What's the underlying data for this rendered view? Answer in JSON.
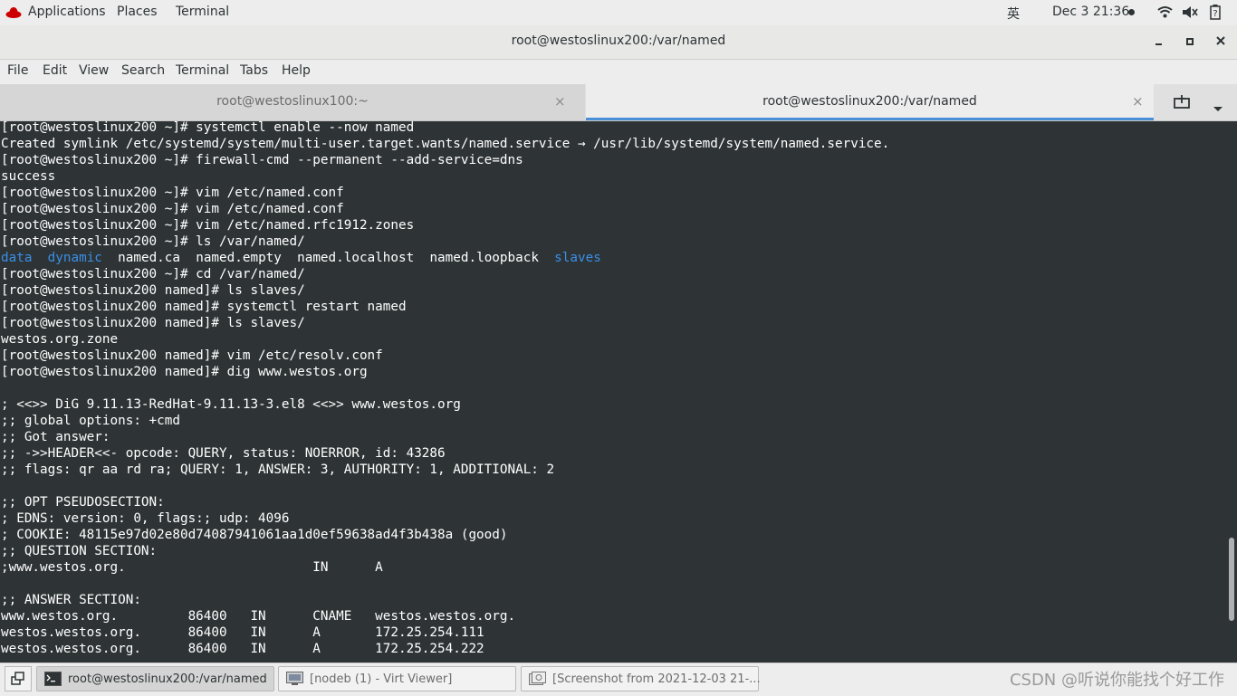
{
  "topbar": {
    "applications": "Applications",
    "places": "Places",
    "terminal": "Terminal",
    "input_method": "英",
    "datetime": "Dec 3  21:36"
  },
  "window": {
    "title": "root@westoslinux200:/var/named"
  },
  "menu": [
    "File",
    "Edit",
    "View",
    "Search",
    "Terminal",
    "Tabs",
    "Help"
  ],
  "tabs": [
    {
      "label": "root@westoslinux100:~"
    },
    {
      "label": "root@westoslinux200:/var/named"
    }
  ],
  "terminal": {
    "lines": [
      "[root@westoslinux200 ~]# systemctl enable --now named",
      "Created symlink /etc/systemd/system/multi-user.target.wants/named.service → /usr/lib/systemd/system/named.service.",
      "[root@westoslinux200 ~]# firewall-cmd --permanent --add-service=dns",
      "success",
      "[root@westoslinux200 ~]# vim /etc/named.conf",
      "[root@westoslinux200 ~]# vim /etc/named.conf",
      "[root@westoslinux200 ~]# vim /etc/named.rfc1912.zones",
      "[root@westoslinux200 ~]# ls /var/named/",
      "",
      "[root@westoslinux200 ~]# cd /var/named/",
      "[root@westoslinux200 named]# ls slaves/",
      "[root@westoslinux200 named]# systemctl restart named",
      "[root@westoslinux200 named]# ls slaves/",
      "westos.org.zone",
      "[root@westoslinux200 named]# vim /etc/resolv.conf",
      "[root@westoslinux200 named]# dig www.westos.org",
      "",
      "; <<>> DiG 9.11.13-RedHat-9.11.13-3.el8 <<>> www.westos.org",
      ";; global options: +cmd",
      ";; Got answer:",
      ";; ->>HEADER<<- opcode: QUERY, status: NOERROR, id: 43286",
      ";; flags: qr aa rd ra; QUERY: 1, ANSWER: 3, AUTHORITY: 1, ADDITIONAL: 2",
      "",
      ";; OPT PSEUDOSECTION:",
      "; EDNS: version: 0, flags:; udp: 4096",
      "; COOKIE: 48115e97d02e80d74087941061aa1d0ef59638ad4f3b438a (good)",
      ";; QUESTION SECTION:",
      ";www.westos.org.                        IN      A",
      "",
      ";; ANSWER SECTION:",
      "www.westos.org.         86400   IN      CNAME   westos.westos.org.",
      "westos.westos.org.      86400   IN      A       172.25.254.111",
      "westos.westos.org.      86400   IN      A       172.25.254.222"
    ],
    "ls_output": {
      "dir1": "data",
      "dir2": "dynamic",
      "files": "named.ca  named.empty  named.localhost  named.loopback",
      "dir3": "slaves"
    }
  },
  "taskbar": {
    "items": [
      {
        "label": "root@westoslinux200:/var/named"
      },
      {
        "label": "[nodeb (1) - Virt Viewer]"
      },
      {
        "label": "[Screenshot from 2021-12-03 21-..."
      }
    ]
  },
  "watermark": "CSDN @听说你能找个好工作"
}
